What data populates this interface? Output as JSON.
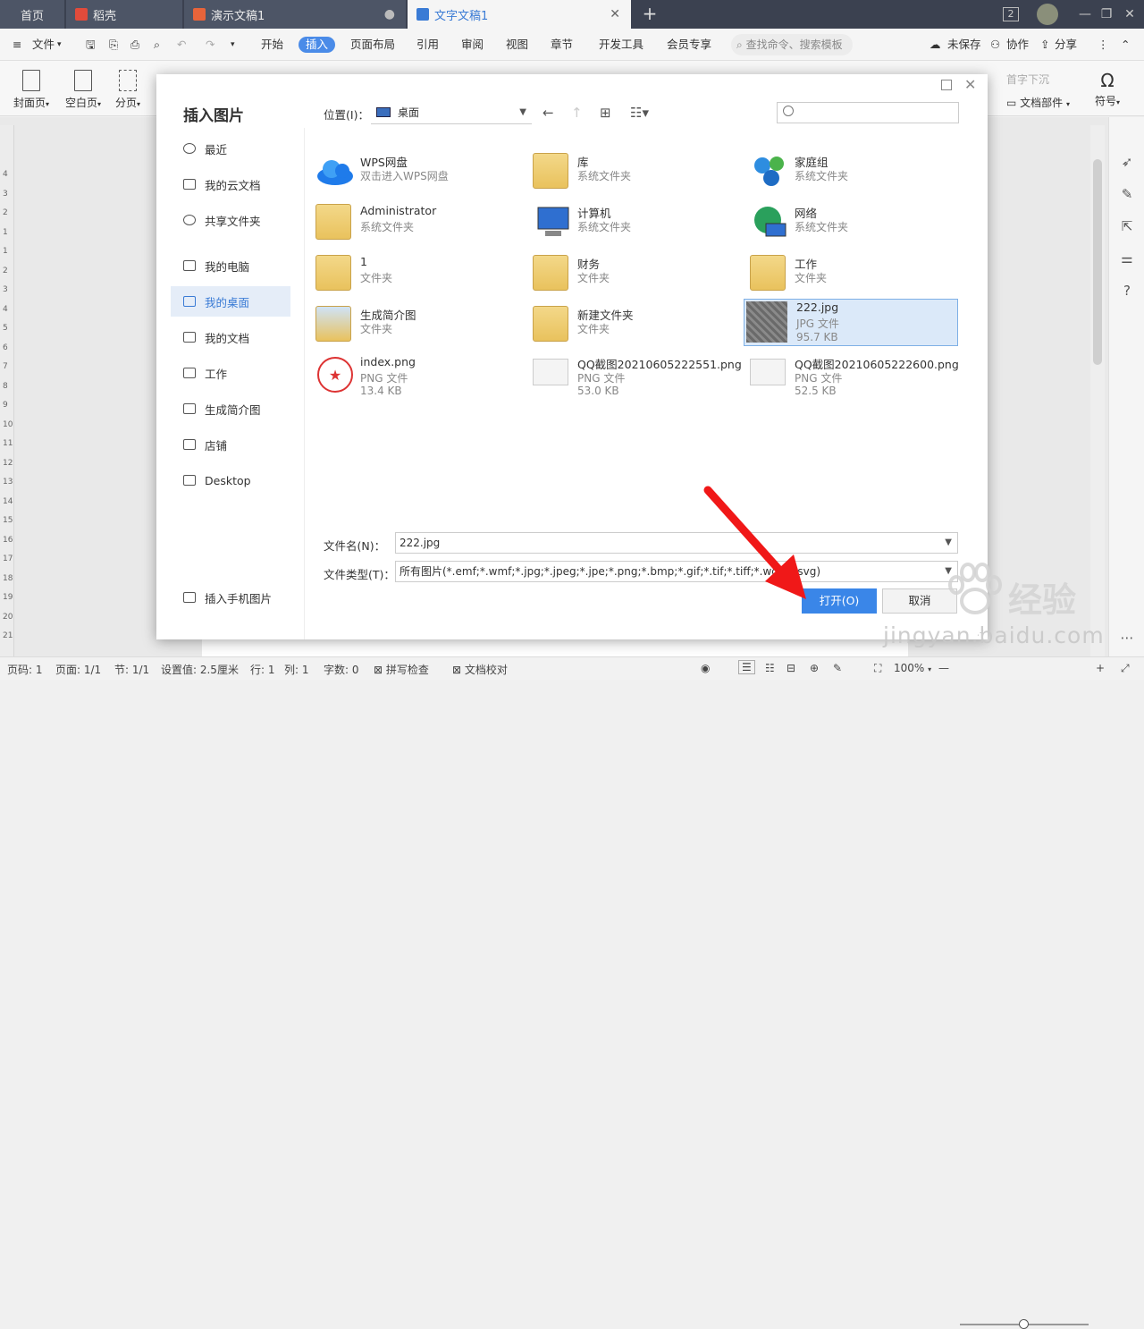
{
  "tabs": {
    "home": "首页",
    "t1": "稻壳",
    "t2": "演示文稿1",
    "t3": "文字文稿1",
    "badge": "2"
  },
  "menu": {
    "file": "文件",
    "items": [
      "开始",
      "插入",
      "页面布局",
      "引用",
      "审阅",
      "视图",
      "章节",
      "开发工具",
      "会员专享"
    ],
    "active": "插入",
    "search": "查找命令、搜索模板",
    "unsaved": "未保存",
    "collab": "协作",
    "share": "分享"
  },
  "ribbon": {
    "cover": "封面页",
    "blank": "空白页",
    "pagebreak": "分页",
    "doc_parts": "文档部件",
    "symbol": "符号",
    "dropcap": "首字下沉"
  },
  "dialog": {
    "title": "插入图片",
    "location_label": "位置(I)：",
    "location_value": "桌面",
    "sidebar": [
      "最近",
      "我的云文档",
      "共享文件夹",
      "我的电脑",
      "我的桌面",
      "我的文档",
      "工作",
      "生成简介图",
      "店铺",
      "Desktop"
    ],
    "phone": "插入手机图片",
    "files": [
      {
        "name": "WPS网盘",
        "type": "双击进入WPS网盘"
      },
      {
        "name": "库",
        "type": "系统文件夹"
      },
      {
        "name": "家庭组",
        "type": "系统文件夹"
      },
      {
        "name": "Administrator",
        "type": "系统文件夹"
      },
      {
        "name": "计算机",
        "type": "系统文件夹"
      },
      {
        "name": "网络",
        "type": "系统文件夹"
      },
      {
        "name": "1",
        "type": "文件夹"
      },
      {
        "name": "财务",
        "type": "文件夹"
      },
      {
        "name": "工作",
        "type": "文件夹"
      },
      {
        "name": "生成简介图",
        "type": "文件夹"
      },
      {
        "name": "新建文件夹",
        "type": "文件夹"
      },
      {
        "name": "222.jpg",
        "type": "JPG 文件",
        "size": "95.7 KB"
      },
      {
        "name": "index.png",
        "type": "PNG 文件",
        "size": "13.4 KB"
      },
      {
        "name": "QQ截图20210605222551.png",
        "type": "PNG 文件",
        "size": "53.0 KB"
      },
      {
        "name": "QQ截图20210605222600.png",
        "type": "PNG 文件",
        "size": "52.5 KB"
      }
    ],
    "filename_label": "文件名(N)：",
    "filename_value": "222.jpg",
    "filetype_label": "文件类型(T)：",
    "filetype_value": "所有图片(*.emf;*.wmf;*.jpg;*.jpeg;*.jpe;*.png;*.bmp;*.gif;*.tif;*.tiff;*.wdp;*.svg)",
    "open": "打开(O)",
    "cancel": "取消"
  },
  "status": {
    "page": "页码: 1",
    "pages": "页面: 1/1",
    "section": "节: 1/1",
    "setting": "设置值: 2.5厘米",
    "row": "行: 1",
    "col": "列: 1",
    "words": "字数: 0",
    "spell": "拼写检查",
    "proof": "文档校对",
    "zoom": "100%"
  },
  "watermark": {
    "brand": "经验",
    "url": "jingyan.baidu.com"
  },
  "ruler_numbers": [
    "4",
    "3",
    "2",
    "1",
    "1",
    "2",
    "3",
    "4",
    "5",
    "6",
    "7",
    "8",
    "9",
    "10",
    "11",
    "12",
    "13",
    "14",
    "15",
    "16",
    "17",
    "18",
    "19",
    "20",
    "21"
  ]
}
